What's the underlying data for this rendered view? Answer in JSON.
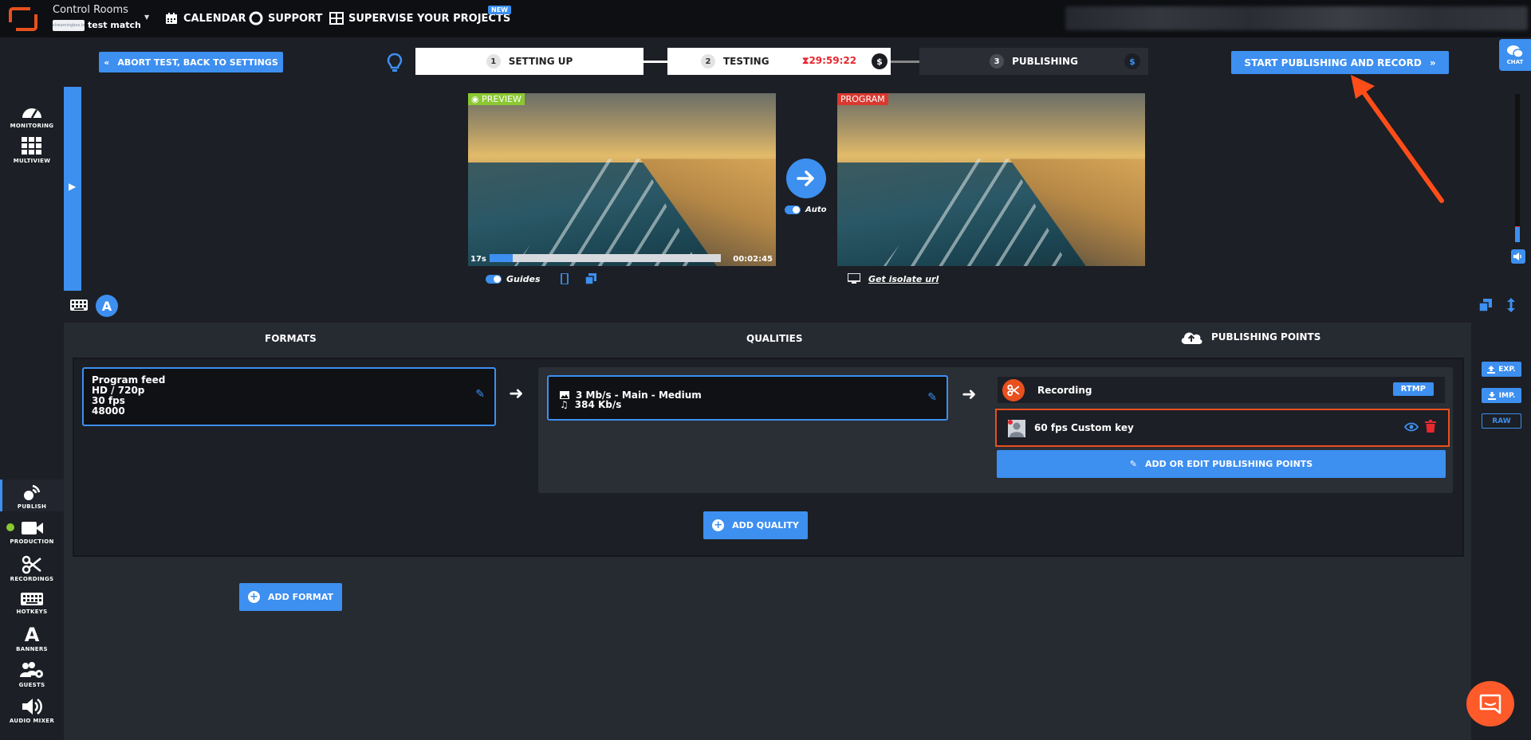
{
  "topnav": {
    "app_title": "Control Rooms",
    "project_thumb": "streamingbox.io",
    "project_name": "test match",
    "links": {
      "calendar": "CALENDAR",
      "support": "SUPPORT",
      "supervise": "SUPERVISE YOUR PROJECTS"
    },
    "new_badge": "NEW"
  },
  "steps_bar": {
    "abort_label": "ABORT TEST, BACK TO SETTINGS",
    "steps": [
      {
        "num": "1",
        "label": "SETTING UP"
      },
      {
        "num": "2",
        "label": "TESTING"
      },
      {
        "num": "3",
        "label": "PUBLISHING"
      }
    ],
    "timer": "29:59:22",
    "dollar": "$",
    "start_label": "START PUBLISHING AND RECORD",
    "chat_label": "CHAT"
  },
  "sidebar": {
    "top": [
      {
        "label": "MONITORING"
      },
      {
        "label": "MULTIVIEW"
      }
    ],
    "bottom": [
      {
        "label": "PUBLISH"
      },
      {
        "label": "PRODUCTION"
      },
      {
        "label": "RECORDINGS"
      },
      {
        "label": "HOTKEYS"
      },
      {
        "label": "BANNERS"
      },
      {
        "label": "GUESTS"
      },
      {
        "label": "AUDIO MIXER"
      }
    ]
  },
  "video": {
    "preview_tag": "PREVIEW",
    "program_tag": "PROGRAM",
    "elapsed": "17s",
    "duration": "00:02:45",
    "progress_fraction": 0.1,
    "auto_label": "Auto",
    "guides_label": "Guides",
    "isolate_label": "Get isolate url",
    "vu_level_fraction": 0.1
  },
  "subbar": {
    "a_label": "A"
  },
  "publish": {
    "formats_head": "FORMATS",
    "qualities_head": "QUALITIES",
    "points_head": "PUBLISHING POINTS",
    "format": {
      "line1": "Program feed",
      "line2": "HD / 720p",
      "line3": "30 fps",
      "line4": "48000"
    },
    "quality": {
      "video": "3 Mb/s  -  Main  -  Medium",
      "audio": "384 Kb/s"
    },
    "recording": {
      "label": "Recording",
      "protocol": "RTMP"
    },
    "custom_key": {
      "label": "60 fps Custom key"
    },
    "add_points_label": "ADD OR EDIT PUBLISHING POINTS",
    "add_quality_label": "ADD QUALITY",
    "add_format_label": "ADD FORMAT"
  },
  "right_tools": {
    "close": "✕",
    "exp": "EXP.",
    "imp": "IMP.",
    "raw": "RAW"
  },
  "colors": {
    "accent": "#3d8ff0",
    "danger": "#e8282f",
    "highlight": "#e8501e",
    "live": "#8bc832"
  }
}
